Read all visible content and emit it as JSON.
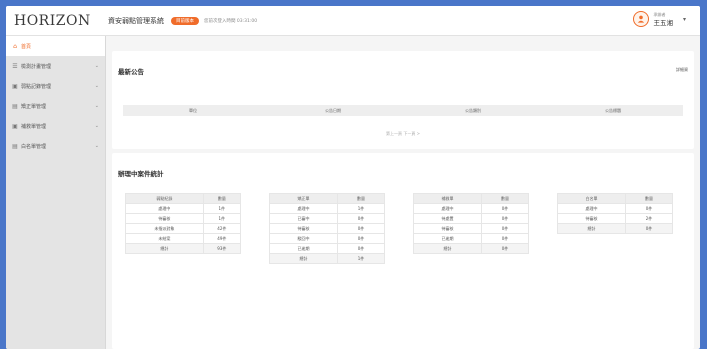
{
  "header": {
    "logo": "HORIZON",
    "system_title": "資安弱點管理系統",
    "badge": "目前版本",
    "last_login": "您前次登入時間 03:31:00",
    "user_role": "承辦者",
    "user_name": "王五湘"
  },
  "sidebar": {
    "items": [
      {
        "label": "首頁",
        "icon": "house-icon",
        "glyph": "⌂"
      },
      {
        "label": "檢測計畫管理",
        "icon": "list-icon",
        "glyph": "☰"
      },
      {
        "label": "弱點記錄管理",
        "icon": "record-icon",
        "glyph": "▣"
      },
      {
        "label": "矯正單管理",
        "icon": "document-icon",
        "glyph": "▤"
      },
      {
        "label": "補救單管理",
        "icon": "form-icon",
        "glyph": "▣"
      },
      {
        "label": "白名單管理",
        "icon": "whitelist-icon",
        "glyph": "▤"
      }
    ]
  },
  "announcements": {
    "title": "最新公告",
    "more": "詳細資",
    "columns": [
      "單位",
      "公告日期",
      "公告類別",
      "公告標題"
    ],
    "pager": "第上一頁 下一頁 >"
  },
  "stats": {
    "title": "辦理中案件統計",
    "tables": [
      {
        "headers": [
          "弱點紀錄",
          "數量"
        ],
        "rows": [
          [
            "處理中",
            "1件"
          ],
          [
            "待審核",
            "1件"
          ],
          [
            "未指派對象",
            "42件"
          ],
          [
            "未結案",
            "49件"
          ]
        ],
        "total": [
          "總計",
          "93件"
        ]
      },
      {
        "headers": [
          "矯正單",
          "數量"
        ],
        "rows": [
          [
            "處理中",
            "1件"
          ],
          [
            "已審中",
            "0件"
          ],
          [
            "待審核",
            "0件"
          ],
          [
            "駁回中",
            "0件"
          ],
          [
            "已逾期",
            "0件"
          ]
        ],
        "total": [
          "總計",
          "1件"
        ]
      },
      {
        "headers": [
          "補救單",
          "數量"
        ],
        "rows": [
          [
            "處理中",
            "0件"
          ],
          [
            "待處置",
            "0件"
          ],
          [
            "待審核",
            "0件"
          ],
          [
            "已逾期",
            "0件"
          ]
        ],
        "total": [
          "總計",
          "0件"
        ]
      },
      {
        "headers": [
          "白名單",
          "數量"
        ],
        "rows": [
          [
            "處理中",
            "0件"
          ],
          [
            "待審核",
            "2件"
          ]
        ],
        "total": [
          "總計",
          "0件"
        ]
      }
    ]
  },
  "colors": {
    "accent": "#f06c2a",
    "sidebar_bg": "#e4e4e4",
    "backdrop": "#4a76c9"
  }
}
